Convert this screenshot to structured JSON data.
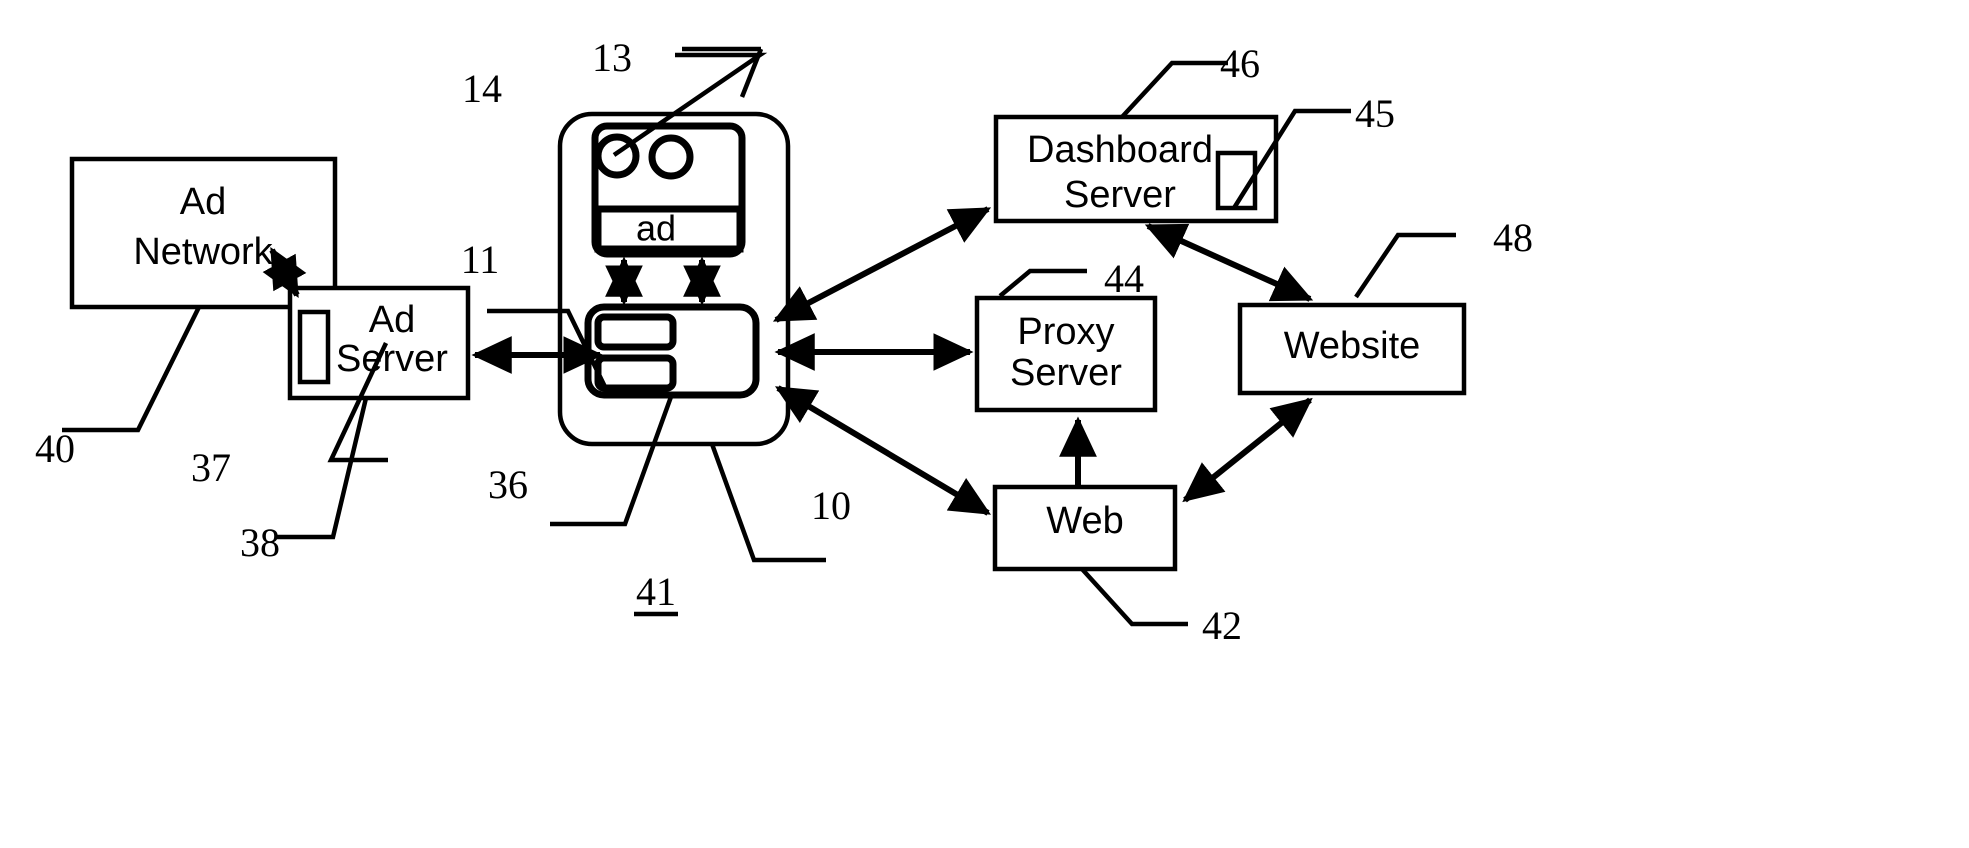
{
  "figure": {
    "title": "Ad delivery system block diagram",
    "background_color": "#ffffff",
    "line_color": "#000000"
  },
  "boxes": {
    "ad_network": {
      "label_line1": "Ad",
      "label_line2": "Network"
    },
    "ad_server": {
      "label_line1": "Ad",
      "label_line2": "Server"
    },
    "dashboard_server": {
      "label_line1": "Dashboard",
      "label_line2": "Server"
    },
    "proxy_server": {
      "label_line1": "Proxy",
      "label_line2": "Server"
    },
    "website": {
      "label": "Website"
    },
    "web": {
      "label": "Web"
    },
    "ad_slot": {
      "label": "ad"
    }
  },
  "reference_numerals": {
    "n40": "40",
    "n37": "37",
    "n38": "38",
    "n36": "36",
    "n41": "41",
    "n10": "10",
    "n11": "11",
    "n13": "13",
    "n14": "14",
    "n42": "42",
    "n44": "44",
    "n45": "45",
    "n46": "46",
    "n48": "48"
  }
}
